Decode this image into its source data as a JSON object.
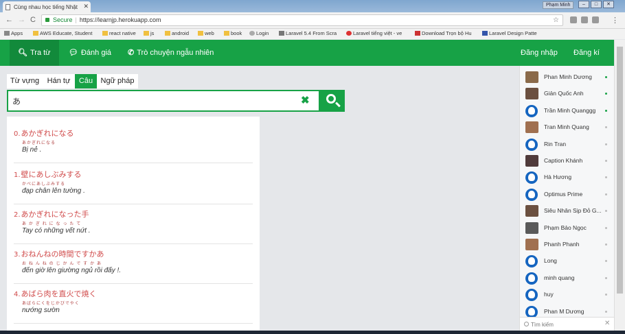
{
  "browser": {
    "tab_title": "Cùng nhau học tiếng Nhật",
    "profile": "Phạm Minh",
    "secure_label": "Secure",
    "url": "https://learnjp.herokuapp.com"
  },
  "bookmarks": [
    "Apps",
    "AWS Educate, Student",
    "react native",
    "js",
    "android",
    "web",
    "book",
    "Login",
    "Laravel 5.4 From Scra",
    "Laravel tiếng việt - ve",
    "Download Trọn bộ Hu",
    "Laravel Design Patte"
  ],
  "navbar": {
    "search": "Tra từ",
    "review": "Đánh giá",
    "chat": "Trò chuyện ngẫu nhiên",
    "login": "Đăng nhập",
    "register": "Đăng kí"
  },
  "search_tabs": [
    "Từ vựng",
    "Hán tự",
    "Câu",
    "Ngữ pháp"
  ],
  "search": {
    "value": "あ"
  },
  "results": [
    {
      "num": "0.",
      "jp": "あかぎれになる",
      "furi": "あかぎれになる",
      "meaning": "Bị nẻ ."
    },
    {
      "num": "1.",
      "jp": "壁にあしぶみする",
      "furi": "かべにあしぶみする",
      "meaning": "đạp chân lên tường ."
    },
    {
      "num": "2.",
      "jp": "あかぎれになった手",
      "furi": "あ か ぎ れ に な っ た て",
      "meaning": "Tay có những vết nứt ."
    },
    {
      "num": "3.",
      "jp": "おねんねの時間ですかあ",
      "furi": "お ね ん ね の じ か ん で す か あ",
      "meaning": "đến giờ lên giường ngủ rồi đấy !."
    },
    {
      "num": "4.",
      "jp": "あばら肉を直火で焼く",
      "furi": "あばらにくをじかびでやく",
      "meaning": "nướng sườn"
    }
  ],
  "users": [
    {
      "name": "Phan Minh Dương",
      "online": true,
      "avatar": "photo"
    },
    {
      "name": "Giản Quốc Anh",
      "online": true,
      "avatar": "photo"
    },
    {
      "name": "Trần Minh Quanggg",
      "online": true,
      "avatar": "default"
    },
    {
      "name": "Tran Minh Quang",
      "online": false,
      "avatar": "photo"
    },
    {
      "name": "Rin Tran",
      "online": false,
      "avatar": "default"
    },
    {
      "name": "Caption Khánh",
      "online": false,
      "avatar": "photo"
    },
    {
      "name": "Hà Hương",
      "online": false,
      "avatar": "default"
    },
    {
      "name": "Optimus Prime",
      "online": false,
      "avatar": "default"
    },
    {
      "name": "Siêu Nhân Sịp Đỏ G...",
      "online": false,
      "avatar": "photo"
    },
    {
      "name": "Phạm Bảo Ngọc",
      "online": false,
      "avatar": "photo"
    },
    {
      "name": "Phanh Phanh",
      "online": false,
      "avatar": "photo"
    },
    {
      "name": "Long",
      "online": false,
      "avatar": "default"
    },
    {
      "name": "minh quang",
      "online": false,
      "avatar": "default"
    },
    {
      "name": "huy",
      "online": false,
      "avatar": "default"
    },
    {
      "name": "Phan M Dương",
      "online": false,
      "avatar": "default"
    }
  ],
  "user_search": {
    "placeholder": "Tìm kiếm"
  },
  "colors": {
    "brand": "#17a246",
    "online": "#17a246",
    "accent_text": "#d04a4a"
  }
}
